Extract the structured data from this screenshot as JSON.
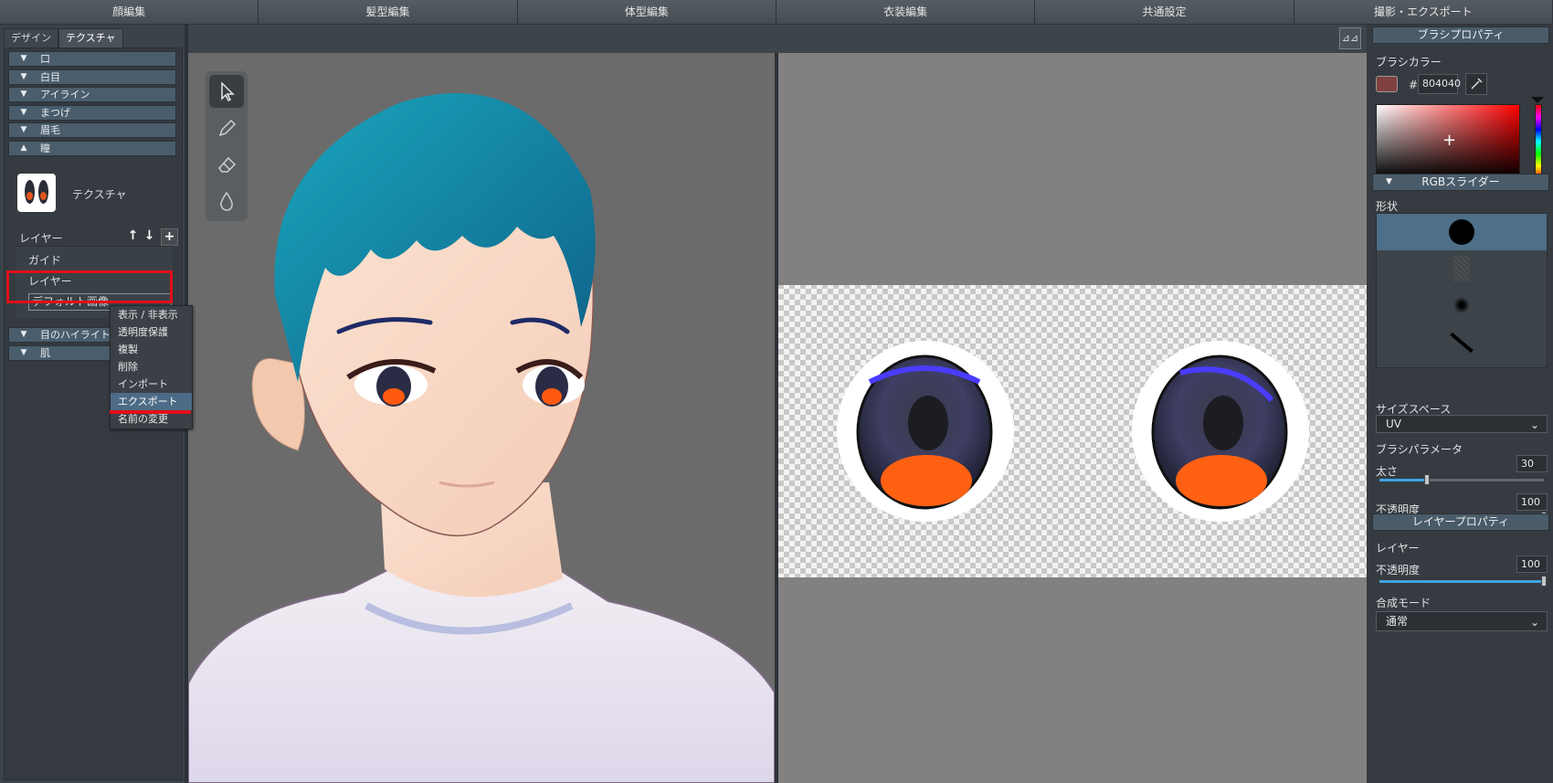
{
  "top_tabs": [
    "顔編集",
    "髪型編集",
    "体型編集",
    "衣装編集",
    "共通設定",
    "撮影・エクスポート"
  ],
  "left_panel": {
    "tabs": [
      "デザイン",
      "テクスチャ"
    ],
    "sections_above": [
      "口",
      "白目",
      "アイライン",
      "まつげ",
      "眉毛"
    ],
    "open_section": "瞳",
    "texture_label": "テクスチャ",
    "layer_header": "レイヤー",
    "layer_buttons": [
      "↑",
      "↓",
      "+"
    ],
    "layers": [
      "ガイド",
      "レイヤー",
      "デフォルト画像"
    ],
    "sections_below": [
      "目のハイライト",
      "肌"
    ]
  },
  "context_menu": {
    "items": [
      "表示 / 非表示",
      "透明度保護",
      "複製",
      "削除",
      "インポート",
      "エクスポート",
      "名前の変更"
    ],
    "selected": "エクスポート"
  },
  "tools": [
    "select-tool",
    "pen-tool",
    "eraser-tool",
    "fill-tool"
  ],
  "right_panel": {
    "brush_props_title": "ブラシプロパティ",
    "brush_color_label": "ブラシカラー",
    "hash": "#",
    "hex_value": "804040",
    "color": "#804040",
    "rgb_slider_label": "RGBスライダー",
    "shape_label": "形状",
    "size_space_label": "サイズスペース",
    "size_space_value": "UV",
    "brush_params_label": "ブラシパラメータ",
    "thickness_label": "太さ",
    "thickness_value": "30",
    "thickness_level": 0.29,
    "opacity_label": "不透明度",
    "opacity_value": "100",
    "opacity_level": 1.0,
    "layer_props_title": "レイヤープロパティ",
    "layer_label": "レイヤー",
    "layer_opacity_label": "不透明度",
    "layer_opacity_value": "100",
    "layer_opacity_level": 1.0,
    "blend_mode_label": "合成モード",
    "blend_mode_value": "通常"
  }
}
